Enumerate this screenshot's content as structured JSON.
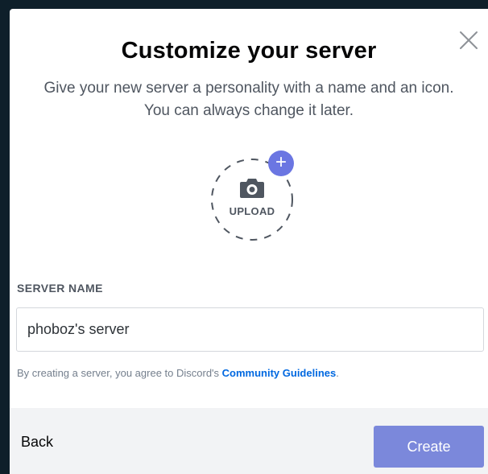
{
  "modal": {
    "title": "Customize your server",
    "subtitle_line1": "Give your new server a personality with a name and an icon.",
    "subtitle_line2": "You can always change it later."
  },
  "upload": {
    "label": "UPLOAD",
    "badge": "+",
    "icon": "camera-icon"
  },
  "server_name": {
    "label": "SERVER NAME",
    "value": "phoboz's server"
  },
  "agreement": {
    "prefix": "By creating a server, you agree to Discord's ",
    "link": "Community Guidelines",
    "suffix": "."
  },
  "footer": {
    "back_label": "Back",
    "create_label": "Create"
  },
  "colors": {
    "accent": "#6b76e2",
    "create_button": "#7b88db",
    "link": "#0068e0"
  }
}
